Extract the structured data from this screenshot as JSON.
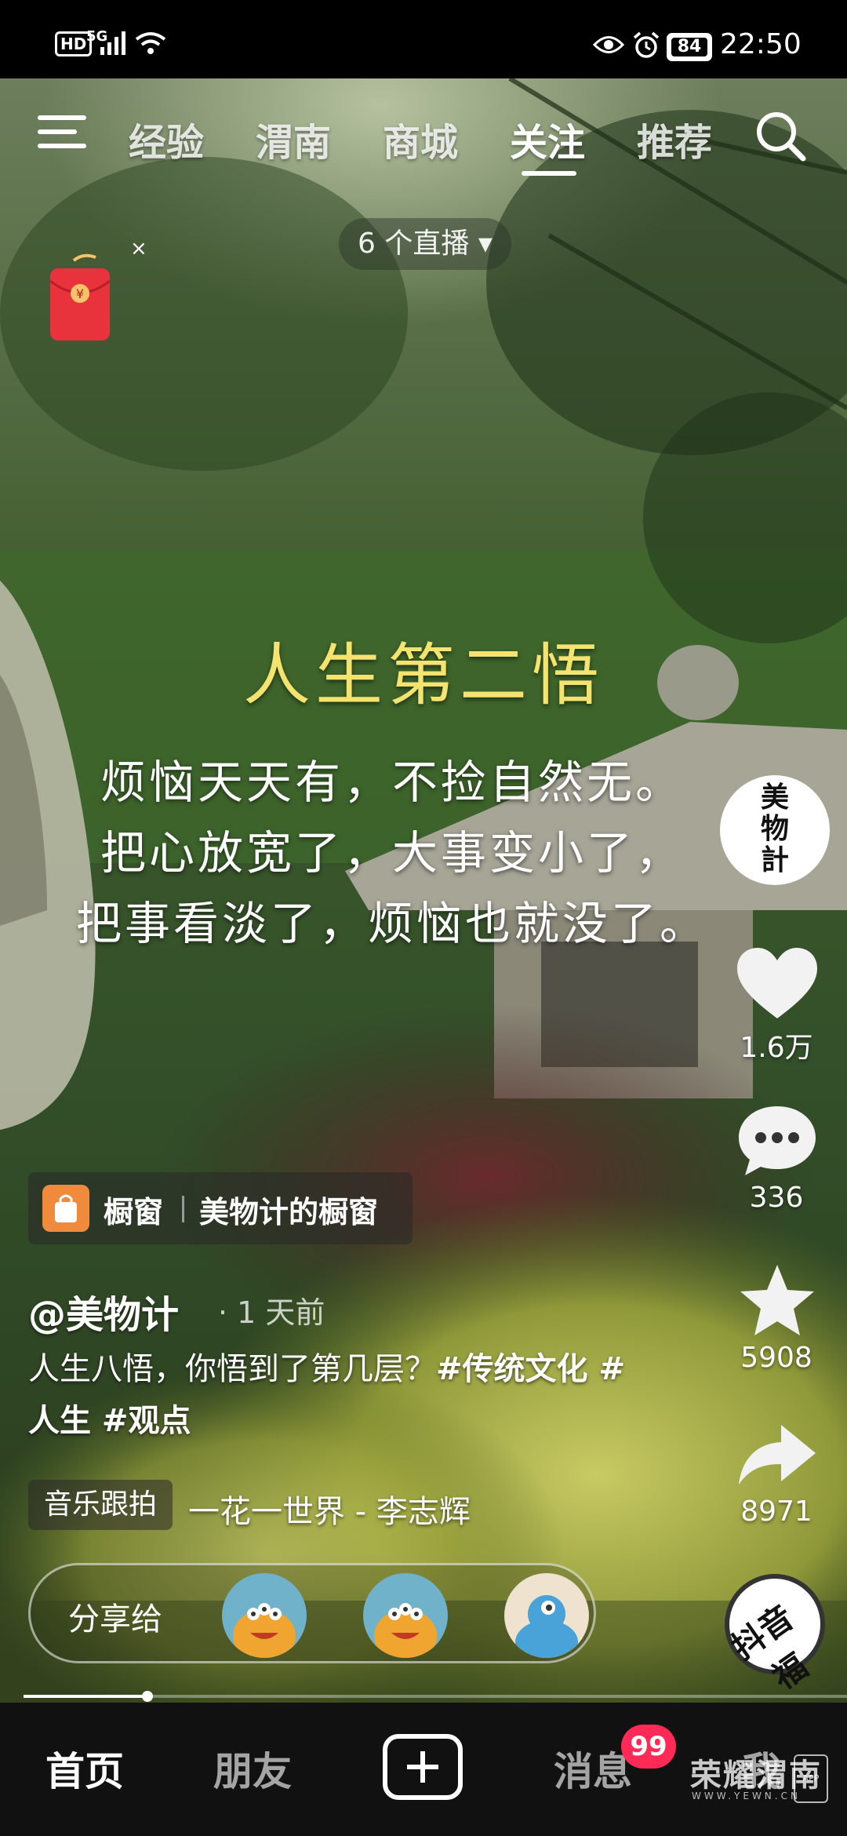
{
  "status_bar": {
    "hd": "HD",
    "network": "5G",
    "battery": "84",
    "time": "22:50"
  },
  "top_nav": {
    "tabs": [
      {
        "label": "经验"
      },
      {
        "label": "渭南"
      },
      {
        "label": "商城"
      },
      {
        "label": "关注",
        "active": true
      },
      {
        "label": "推荐"
      }
    ],
    "menu_icon": "menu-icon",
    "search_icon": "search-icon"
  },
  "live": {
    "label": "6 个直播"
  },
  "red_packet": {
    "icon": "red-envelope-icon",
    "close": "×",
    "symbol": "¥"
  },
  "video": {
    "title": "人生第二悟",
    "lines": [
      "烦恼天天有，不捡自然无。",
      "把心放宽了，大事变小了，",
      "把事看淡了，烦恼也就没了。"
    ]
  },
  "right_rail": {
    "avatar_text": "美物計",
    "likes": "1.6万",
    "comments": "336",
    "favorites": "5908",
    "shares": "8971",
    "music_disc_text": "抖音福"
  },
  "shop": {
    "label": "橱窗",
    "name": "美物计的橱窗"
  },
  "post": {
    "author": "@美物计",
    "time": "· 1 天前",
    "description": "人生八悟，你悟到了第几层？",
    "hashtags": "#传统文化 #人生 #观点"
  },
  "music": {
    "chip": "音乐跟拍",
    "title": "一花一世界 - 李志辉"
  },
  "share": {
    "label": "分享给"
  },
  "progress": {
    "played_fraction": 0.15
  },
  "bottom_nav": {
    "home": "首页",
    "friends": "朋友",
    "messages": "消息",
    "me": "我",
    "badge": "99"
  },
  "watermark": {
    "text": "荣耀渭南",
    "sub": "WWW.YEWN.CN",
    "app": "APP"
  },
  "colors": {
    "title_yellow": "#f4e36e",
    "badge_red": "#ff2a55",
    "shop_orange": "#f08a3c"
  }
}
